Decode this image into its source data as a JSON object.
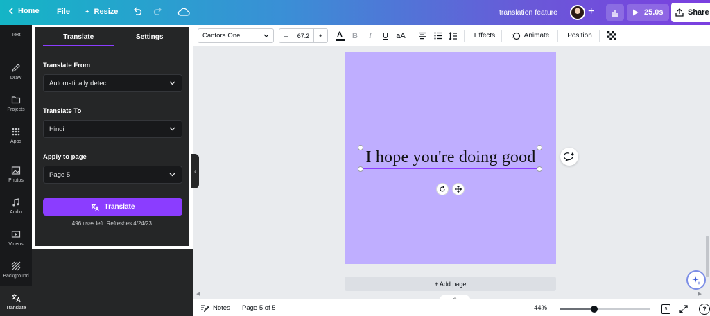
{
  "topbar": {
    "home": "Home",
    "file": "File",
    "resize": "Resize",
    "doc_name": "translation feature",
    "play_duration": "25.0s",
    "share": "Share"
  },
  "rail": {
    "items": [
      {
        "label": "Text",
        "icon": "text-icon"
      },
      {
        "label": "Draw",
        "icon": "draw-icon"
      },
      {
        "label": "Projects",
        "icon": "folder-icon"
      },
      {
        "label": "Apps",
        "icon": "apps-icon"
      },
      {
        "label": "Photos",
        "icon": "photo-icon"
      },
      {
        "label": "Audio",
        "icon": "music-icon"
      },
      {
        "label": "Videos",
        "icon": "video-icon"
      },
      {
        "label": "Background",
        "icon": "background-icon"
      },
      {
        "label": "Translate",
        "icon": "translate-icon"
      }
    ]
  },
  "panel": {
    "tabs": [
      "Translate",
      "Settings"
    ],
    "active_tab": "Translate",
    "translate_from_label": "Translate From",
    "translate_from_value": "Automatically detect",
    "translate_to_label": "Translate To",
    "translate_to_value": "Hindi",
    "apply_label": "Apply to page",
    "apply_value": "Page 5",
    "button": "Translate",
    "uses_note": "496 uses left. Refreshes 4/24/23."
  },
  "toolbar": {
    "font": "Cantora One",
    "size": "67.2",
    "effects": "Effects",
    "animate": "Animate",
    "position": "Position",
    "case_label": "aA"
  },
  "canvas": {
    "text": "I hope you're doing good",
    "page_color": "#bfaeff",
    "add_page": "+ Add page"
  },
  "bottombar": {
    "notes": "Notes",
    "page_indicator": "Page 5 of 5",
    "zoom": "44%",
    "page_count": "5",
    "zoom_level": 0.44
  },
  "colors": {
    "accent": "#8b3dff",
    "panel_bg": "#252627",
    "rail_bg": "#18191b"
  }
}
